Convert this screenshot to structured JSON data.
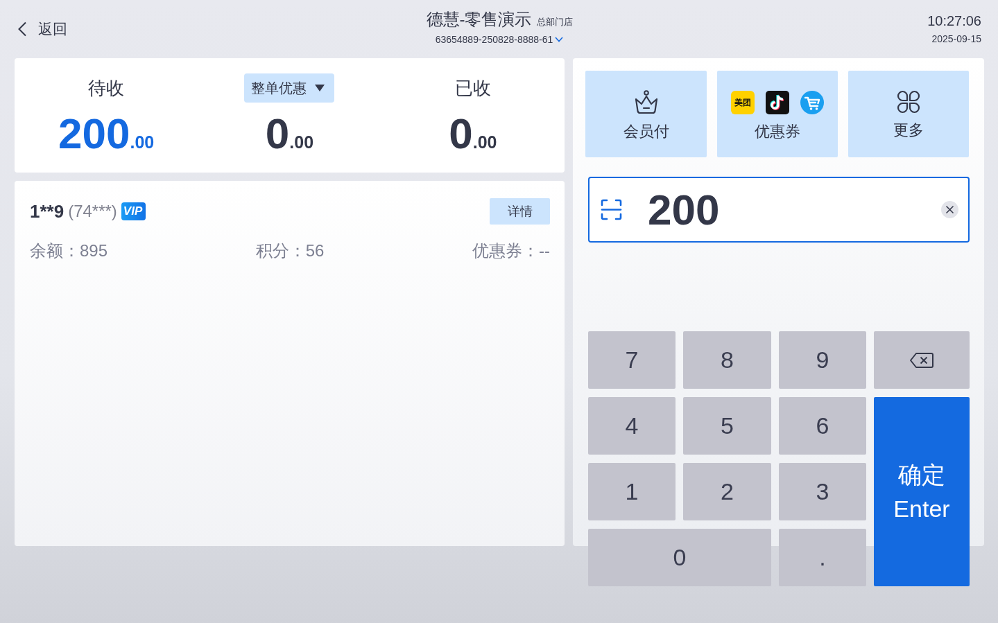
{
  "header": {
    "back": "返回",
    "title": "德慧-零售演示",
    "store": "总部门店",
    "order_number": "63654889-250828-8888-61",
    "time": "10:27:06",
    "date": "2025-09-15"
  },
  "summary": [
    {
      "kind": "text",
      "label": "待收",
      "amount": "200",
      "decimals": ".00",
      "highlighted": true
    },
    {
      "kind": "dropdown",
      "label": "整单优惠",
      "amount": "0",
      "decimals": ".00",
      "highlighted": false
    },
    {
      "kind": "text",
      "label": "已收",
      "amount": "0",
      "decimals": ".00",
      "highlighted": false
    }
  ],
  "member": {
    "name": "1**9",
    "phone": "(74***)",
    "badge": "VIP",
    "details_button": "详情",
    "stats": [
      "余额：895",
      "积分：56",
      "优惠券：--"
    ]
  },
  "pay_options": [
    {
      "kind": "member",
      "label": "会员付"
    },
    {
      "kind": "coupon",
      "label": "优惠券",
      "logos": [
        {
          "kind": "text",
          "text": "美团"
        },
        {
          "kind": "note"
        },
        {
          "kind": "cart"
        }
      ]
    },
    {
      "kind": "more",
      "label": "更多"
    }
  ],
  "amount_field": {
    "value": "200"
  },
  "keypad": {
    "keys": [
      {
        "kind": "key",
        "label": "7"
      },
      {
        "kind": "key",
        "label": "8"
      },
      {
        "kind": "key",
        "label": "9"
      },
      {
        "kind": "key",
        "label": "4"
      },
      {
        "kind": "key",
        "label": "5"
      },
      {
        "kind": "key",
        "label": "6"
      },
      {
        "kind": "key",
        "label": "1"
      },
      {
        "kind": "key",
        "label": "2"
      },
      {
        "kind": "key",
        "label": "3"
      },
      {
        "kind": "wide",
        "label": "0"
      },
      {
        "kind": "key",
        "label": "."
      }
    ],
    "actions": [
      {
        "kind": "backspace"
      },
      {
        "kind": "enter",
        "label": "确定",
        "sublabel": "Enter"
      }
    ]
  }
}
